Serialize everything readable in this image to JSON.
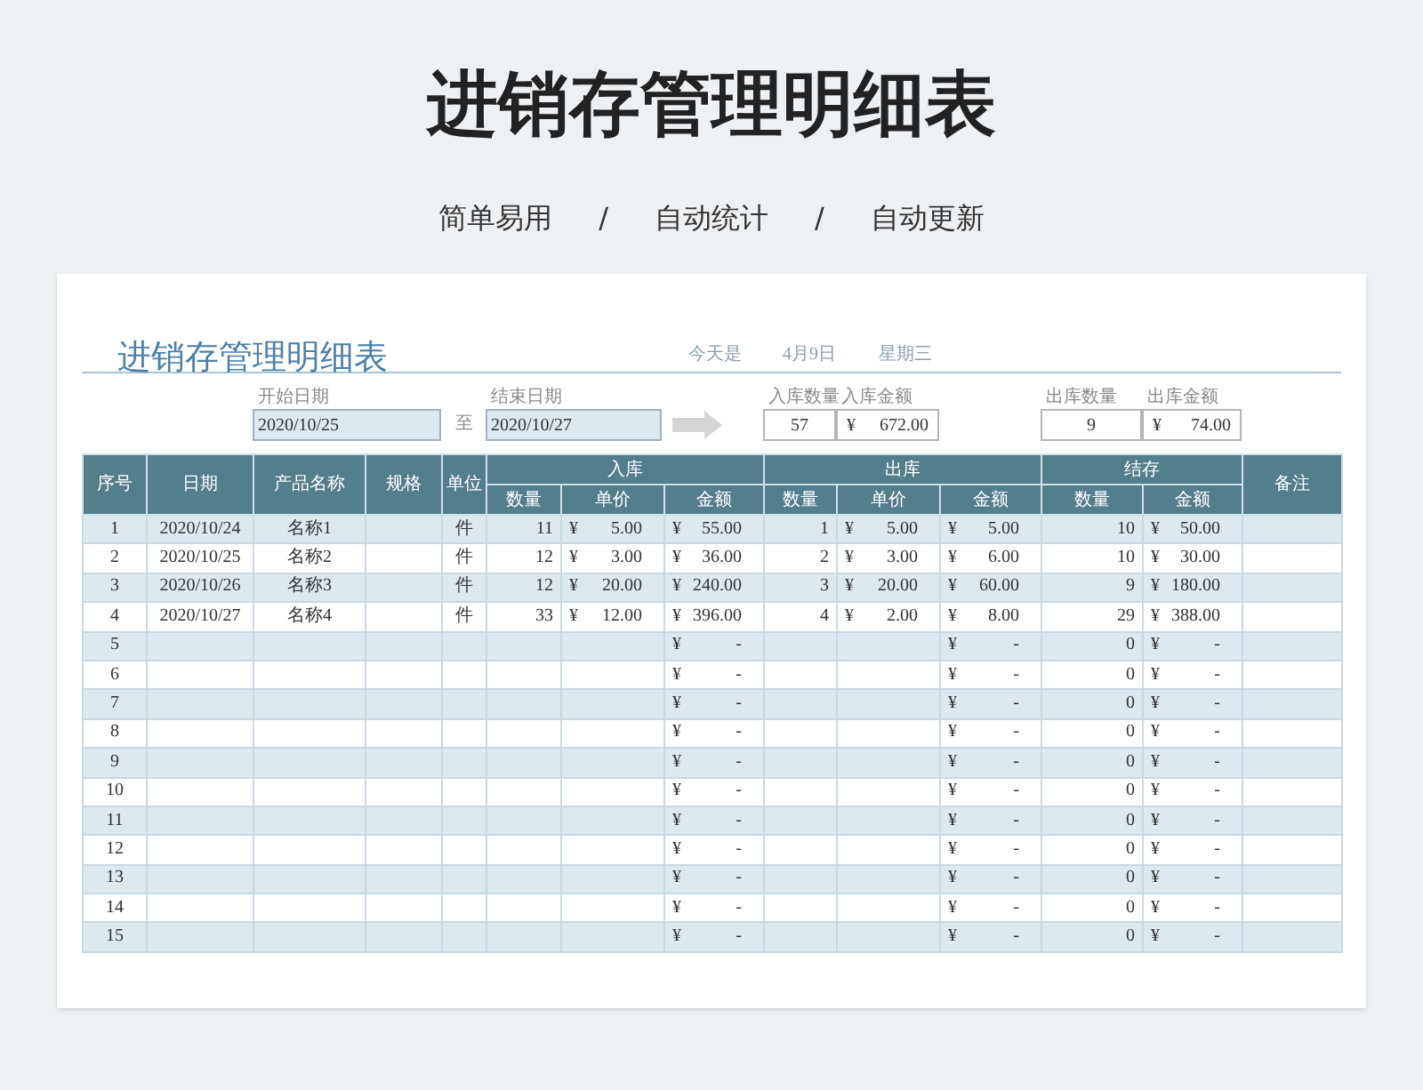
{
  "page_title": "进销存管理明细表",
  "taglines": [
    "简单易用",
    "/",
    "自动统计",
    "/",
    "自动更新"
  ],
  "sheet": {
    "title": "进销存管理明细表",
    "today_label": "今天是",
    "today_date": "4月9日",
    "weekday": "星期三",
    "start_label": "开始日期",
    "start_date": "2020/10/25",
    "range_sep": "至",
    "end_label": "结束日期",
    "end_date": "2020/10/27",
    "summary": [
      {
        "label": "入库数量",
        "value": "57"
      },
      {
        "label": "入库金额",
        "currency": "¥",
        "value": "672.00"
      },
      {
        "label": "出库数量",
        "value": "9"
      },
      {
        "label": "出库金额",
        "currency": "¥",
        "value": "74.00"
      }
    ]
  },
  "table": {
    "columns": [
      "序号",
      "日期",
      "产品名称",
      "规格",
      "单位"
    ],
    "groups": [
      {
        "label": "入库",
        "columns": [
          "数量",
          "单价",
          "金额"
        ]
      },
      {
        "label": "出库",
        "columns": [
          "数量",
          "单价",
          "金额"
        ]
      },
      {
        "label": "结存",
        "columns": [
          "数量",
          "金额"
        ]
      }
    ],
    "last_column": "备注",
    "rows": [
      {
        "no": "1",
        "date": "2020/10/24",
        "name": "名称1",
        "unit": "件",
        "in_qty": "11",
        "in_price": [
          "¥",
          "5.00"
        ],
        "in_amount": [
          "¥",
          "55.00"
        ],
        "out_qty": "1",
        "out_price": [
          "¥",
          "5.00"
        ],
        "out_amount": [
          "¥",
          "5.00"
        ],
        "stock_qty": "10",
        "stock_amount": [
          "¥",
          "50.00"
        ]
      },
      {
        "no": "2",
        "date": "2020/10/25",
        "name": "名称2",
        "unit": "件",
        "in_qty": "12",
        "in_price": [
          "¥",
          "3.00"
        ],
        "in_amount": [
          "¥",
          "36.00"
        ],
        "out_qty": "2",
        "out_price": [
          "¥",
          "3.00"
        ],
        "out_amount": [
          "¥",
          "6.00"
        ],
        "stock_qty": "10",
        "stock_amount": [
          "¥",
          "30.00"
        ]
      },
      {
        "no": "3",
        "date": "2020/10/26",
        "name": "名称3",
        "unit": "件",
        "in_qty": "12",
        "in_price": [
          "¥",
          "20.00"
        ],
        "in_amount": [
          "¥",
          "240.00"
        ],
        "out_qty": "3",
        "out_price": [
          "¥",
          "20.00"
        ],
        "out_amount": [
          "¥",
          "60.00"
        ],
        "stock_qty": "9",
        "stock_amount": [
          "¥",
          "180.00"
        ]
      },
      {
        "no": "4",
        "date": "2020/10/27",
        "name": "名称4",
        "unit": "件",
        "in_qty": "33",
        "in_price": [
          "¥",
          "12.00"
        ],
        "in_amount": [
          "¥",
          "396.00"
        ],
        "out_qty": "4",
        "out_price": [
          "¥",
          "2.00"
        ],
        "out_amount": [
          "¥",
          "8.00"
        ],
        "stock_qty": "29",
        "stock_amount": [
          "¥",
          "388.00"
        ]
      },
      {
        "no": "5",
        "in_amount": [
          "¥",
          "-"
        ],
        "out_amount": [
          "¥",
          "-"
        ],
        "stock_qty": "0",
        "stock_amount": [
          "¥",
          "-"
        ]
      },
      {
        "no": "6",
        "in_amount": [
          "¥",
          "-"
        ],
        "out_amount": [
          "¥",
          "-"
        ],
        "stock_qty": "0",
        "stock_amount": [
          "¥",
          "-"
        ]
      },
      {
        "no": "7",
        "in_amount": [
          "¥",
          "-"
        ],
        "out_amount": [
          "¥",
          "-"
        ],
        "stock_qty": "0",
        "stock_amount": [
          "¥",
          "-"
        ]
      },
      {
        "no": "8",
        "in_amount": [
          "¥",
          "-"
        ],
        "out_amount": [
          "¥",
          "-"
        ],
        "stock_qty": "0",
        "stock_amount": [
          "¥",
          "-"
        ]
      },
      {
        "no": "9",
        "in_amount": [
          "¥",
          "-"
        ],
        "out_amount": [
          "¥",
          "-"
        ],
        "stock_qty": "0",
        "stock_amount": [
          "¥",
          "-"
        ]
      },
      {
        "no": "10",
        "in_amount": [
          "¥",
          "-"
        ],
        "out_amount": [
          "¥",
          "-"
        ],
        "stock_qty": "0",
        "stock_amount": [
          "¥",
          "-"
        ]
      },
      {
        "no": "11",
        "in_amount": [
          "¥",
          "-"
        ],
        "out_amount": [
          "¥",
          "-"
        ],
        "stock_qty": "0",
        "stock_amount": [
          "¥",
          "-"
        ]
      },
      {
        "no": "12",
        "in_amount": [
          "¥",
          "-"
        ],
        "out_amount": [
          "¥",
          "-"
        ],
        "stock_qty": "0",
        "stock_amount": [
          "¥",
          "-"
        ]
      },
      {
        "no": "13",
        "in_amount": [
          "¥",
          "-"
        ],
        "out_amount": [
          "¥",
          "-"
        ],
        "stock_qty": "0",
        "stock_amount": [
          "¥",
          "-"
        ]
      },
      {
        "no": "14",
        "in_amount": [
          "¥",
          "-"
        ],
        "out_amount": [
          "¥",
          "-"
        ],
        "stock_qty": "0",
        "stock_amount": [
          "¥",
          "-"
        ]
      },
      {
        "no": "15",
        "in_amount": [
          "¥",
          "-"
        ],
        "out_amount": [
          "¥",
          "-"
        ],
        "stock_qty": "0",
        "stock_amount": [
          "¥",
          "-"
        ]
      }
    ]
  }
}
